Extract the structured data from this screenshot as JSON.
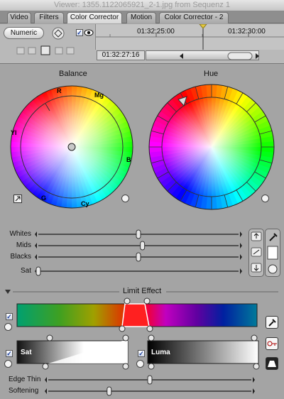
{
  "window": {
    "title": "Viewer: 1355.1122065921_2-1.jpg from Sequenz 1"
  },
  "tabs": [
    {
      "label": "Video"
    },
    {
      "label": "Filters"
    },
    {
      "label": "Color Corrector"
    },
    {
      "label": "Motion"
    },
    {
      "label": "Color Corrector - 2"
    }
  ],
  "toolbar": {
    "numeric_label": "Numeric",
    "timeline_start": "01:32:25:00",
    "timeline_end": "01:32:30:00",
    "current_timecode": "01:32:27:16"
  },
  "balance": {
    "title": "Balance",
    "labels": {
      "r": "R",
      "mg": "Mg",
      "yl": "Yl",
      "b": "B",
      "g": "G",
      "cy": "Cy"
    }
  },
  "hue": {
    "title": "Hue"
  },
  "level_sliders": [
    {
      "label": "Whites",
      "value": 0.5
    },
    {
      "label": "Mids",
      "value": 0.52
    },
    {
      "label": "Blacks",
      "value": 0.5
    },
    {
      "label": "Sat",
      "value": 0.0
    }
  ],
  "limit_effect": {
    "title": "Limit Effect",
    "sat_label": "Sat",
    "luma_label": "Luma",
    "edge_thin_label": "Edge Thin",
    "softening_label": "Softening",
    "edge_thin_value": 0.5,
    "softening_value": 0.3
  },
  "colors": {
    "panel_bg": "#a4a4a4",
    "tab_active": "#efefef"
  }
}
